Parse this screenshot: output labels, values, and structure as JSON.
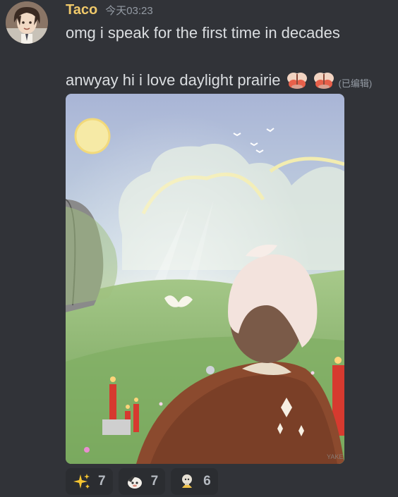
{
  "message": {
    "author": "Taco",
    "timestamp": "今天03:23",
    "line1": "omg i speak for the first time in decades",
    "line2": "anwyay hi i love daylight prairie",
    "edited_label": "(已编辑)",
    "inline_emojis": [
      "prairie-butterfly-emoji",
      "prairie-butterfly-emoji"
    ],
    "attachment_signature": "YAKE"
  },
  "reactions": [
    {
      "emoji": "sparkles",
      "count": "7"
    },
    {
      "emoji": "custom-creature-emoji",
      "count": "7"
    },
    {
      "emoji": "custom-moth-emoji",
      "count": "6"
    }
  ],
  "colors": {
    "background": "#313338",
    "username": "#f0c96a",
    "text": "#dbdee1",
    "muted": "#949ba4",
    "reaction_bg": "#2b2d31"
  }
}
